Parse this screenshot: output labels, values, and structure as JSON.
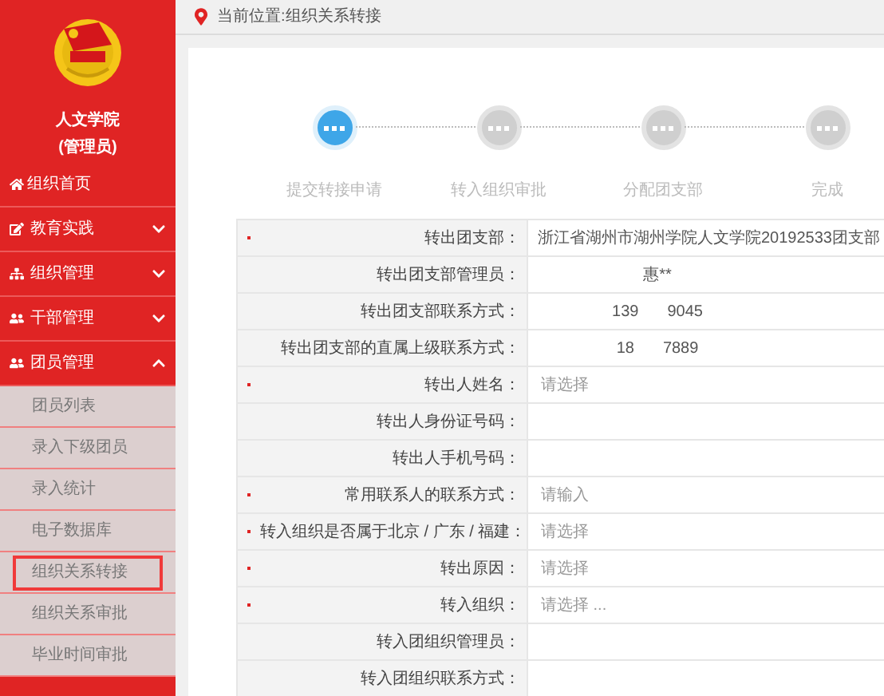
{
  "sidebar": {
    "school": "人文学院",
    "role": "(管理员)",
    "home": "组织首页",
    "menus": [
      {
        "label": "教育实践",
        "expanded": false
      },
      {
        "label": "组织管理",
        "expanded": false
      },
      {
        "label": "干部管理",
        "expanded": false
      },
      {
        "label": "团员管理",
        "expanded": true,
        "children": [
          {
            "label": "团员列表",
            "selected": false
          },
          {
            "label": "录入下级团员",
            "selected": false
          },
          {
            "label": "录入统计",
            "selected": false
          },
          {
            "label": "电子数据库",
            "selected": false
          },
          {
            "label": "组织关系转接",
            "selected": true
          },
          {
            "label": "组织关系审批",
            "selected": false
          },
          {
            "label": "毕业时间审批",
            "selected": false
          }
        ]
      }
    ]
  },
  "breadcrumb": "当前位置:组织关系转接",
  "steps": [
    {
      "label": "提交转接申请",
      "selected": true
    },
    {
      "label": "转入组织审批",
      "selected": false
    },
    {
      "label": "分配团支部",
      "selected": false
    },
    {
      "label": "完成",
      "selected": false
    }
  ],
  "form": [
    {
      "label": "转出团支部：",
      "required": true,
      "kind": "text",
      "value": "浙江省湖州市湖州学院人文学院20192533团支部"
    },
    {
      "label": "转出团支部管理员：",
      "required": false,
      "kind": "info",
      "parts": [
        "惠**"
      ]
    },
    {
      "label": "转出团支部联系方式：",
      "required": false,
      "kind": "info",
      "parts": [
        "139",
        "9045"
      ]
    },
    {
      "label": "转出团支部的直属上级联系方式：",
      "required": false,
      "kind": "info",
      "parts": [
        "18",
        "7889"
      ]
    },
    {
      "label": "转出人姓名：",
      "required": true,
      "kind": "input",
      "placeholder": "请选择"
    },
    {
      "label": "转出人身份证号码：",
      "required": false,
      "kind": "empty"
    },
    {
      "label": "转出人手机号码：",
      "required": false,
      "kind": "empty"
    },
    {
      "label": "常用联系人的联系方式：",
      "required": true,
      "kind": "input",
      "placeholder": "请输入"
    },
    {
      "label": "转入组织是否属于北京 / 广东 / 福建：",
      "required": true,
      "kind": "input",
      "placeholder": "请选择"
    },
    {
      "label": "转出原因：",
      "required": true,
      "kind": "input",
      "placeholder": "请选择"
    },
    {
      "label": "转入组织：",
      "required": true,
      "kind": "input",
      "placeholder": "请选择 ..."
    },
    {
      "label": "转入团组织管理员：",
      "required": false,
      "kind": "empty"
    },
    {
      "label": "转入团组织联系方式：",
      "required": false,
      "kind": "empty"
    }
  ]
}
